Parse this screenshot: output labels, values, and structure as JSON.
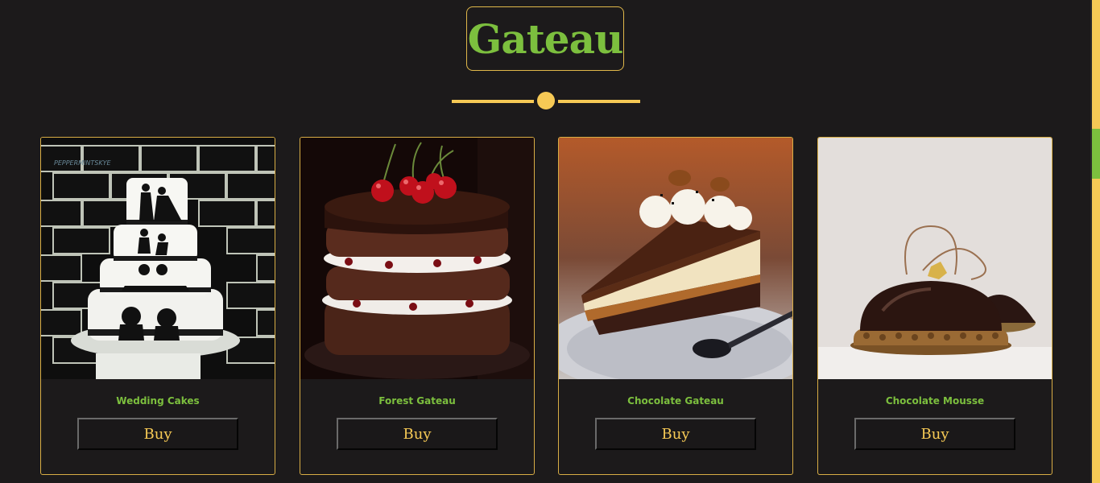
{
  "header": {
    "title": "Gateau"
  },
  "colors": {
    "background": "#1c1a1b",
    "accent_yellow": "#f6c955",
    "accent_green": "#7cbf3e",
    "card_border": "#d8ad45"
  },
  "products": [
    {
      "name": "Wedding Cakes",
      "buy_label": "Buy",
      "image": "wedding-cake-image"
    },
    {
      "name": "Forest Gateau",
      "buy_label": "Buy",
      "image": "black-forest-cake-image"
    },
    {
      "name": "Chocolate Gateau",
      "buy_label": "Buy",
      "image": "chocolate-cake-slice-image"
    },
    {
      "name": "Chocolate Mousse",
      "buy_label": "Buy",
      "image": "chocolate-mousse-dome-image"
    }
  ]
}
